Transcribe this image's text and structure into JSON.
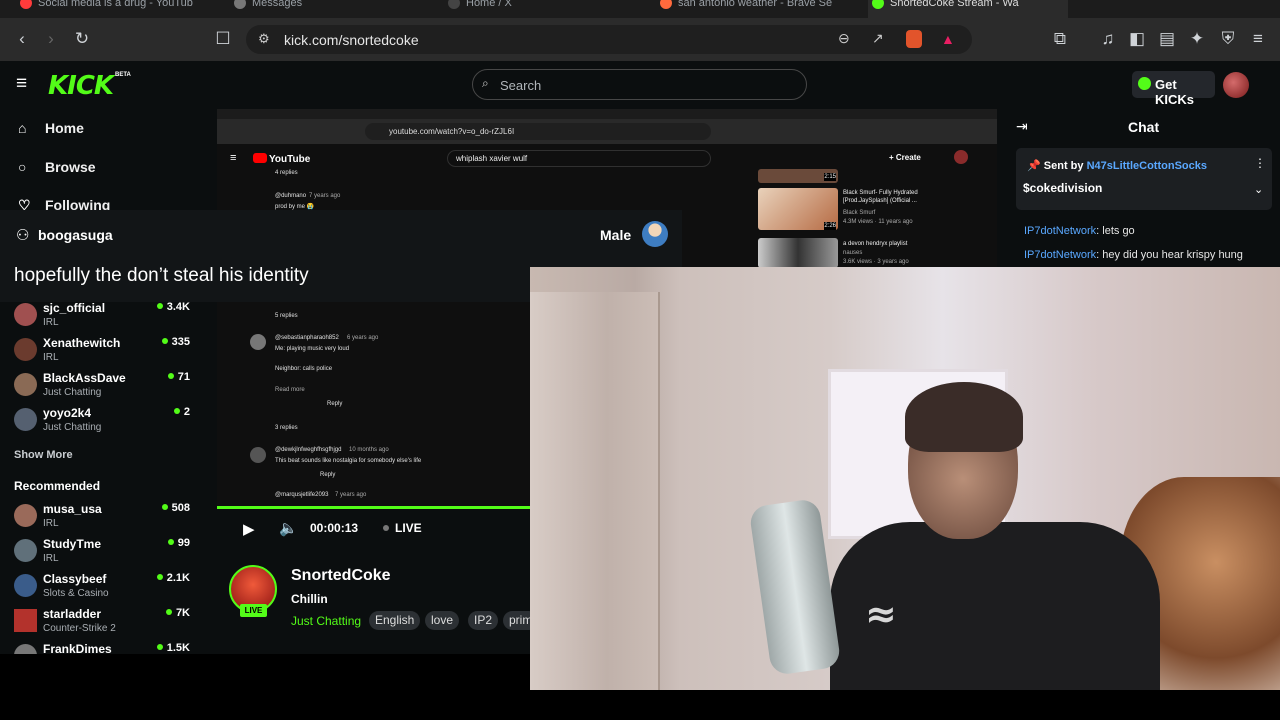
{
  "browser": {
    "tabs": [
      {
        "label": "Social media is a drug - YouTub",
        "color": "#ff3b3b"
      },
      {
        "label": "Messages",
        "color": "#cccccc"
      },
      {
        "label": "Home / X",
        "color": "#ffffff"
      },
      {
        "label": "san antonio weather - Brave Se",
        "color": "#ff6a3d"
      },
      {
        "label": "SnortedCoke Stream - Wa",
        "color": "#53fc18"
      }
    ],
    "url": "kick.com/snortedcoke"
  },
  "header": {
    "logo": "KICK",
    "logo_badge": "BETA",
    "search_placeholder": "Search",
    "get_kicks": "Get KICKs"
  },
  "sidebar": {
    "nav": [
      {
        "label": "Home",
        "icon": "home-icon"
      },
      {
        "label": "Browse",
        "icon": "browse-icon"
      },
      {
        "label": "Following",
        "icon": "heart-icon"
      }
    ],
    "following": [
      {
        "name": "sjc_official",
        "category": "IRL",
        "viewers": "3.4K"
      },
      {
        "name": "Xenathewitch",
        "category": "IRL",
        "viewers": "335"
      },
      {
        "name": "BlackAssDave",
        "category": "Just Chatting",
        "viewers": "71"
      },
      {
        "name": "yoyo2k4",
        "category": "Just Chatting",
        "viewers": "2"
      }
    ],
    "show_more": "Show More",
    "recommended_title": "Recommended",
    "recommended": [
      {
        "name": "musa_usa",
        "category": "IRL",
        "viewers": "508"
      },
      {
        "name": "StudyTme",
        "category": "IRL",
        "viewers": "99"
      },
      {
        "name": "Classybeef",
        "category": "Slots & Casino",
        "viewers": "2.1K"
      },
      {
        "name": "starladder",
        "category": "Counter-Strike 2",
        "viewers": "7K"
      },
      {
        "name": "FrankDimes",
        "category": "",
        "viewers": "1.5K"
      }
    ]
  },
  "alert": {
    "username": "boogasuga",
    "gender": "Male",
    "message": "hopefully the don’t steal his identity"
  },
  "capture": {
    "url": "youtube.com/watch?v=o_do-rZJL6I",
    "search": "whiplash xavier wulf",
    "create": "Create",
    "comments": [
      {
        "text": "4 replies",
        "meta": ""
      },
      {
        "text": "@duhmano",
        "meta": "7 years ago"
      },
      {
        "text": "prod by me 😭",
        "meta": ""
      },
      {
        "text": "5 replies",
        "meta": ""
      },
      {
        "text": "@sebastianpharaoh852",
        "meta": "6 years ago"
      },
      {
        "text": "Me: playing music very loud",
        "meta": ""
      },
      {
        "text": "Neighbor: calls police",
        "meta": ""
      },
      {
        "text": "Read more",
        "meta": ""
      },
      {
        "text": "Reply",
        "meta": ""
      },
      {
        "text": "3 replies",
        "meta": ""
      },
      {
        "text": "@dewkjlnfweghfhsgfhjgd",
        "meta": "10 months ago"
      },
      {
        "text": "This beat sounds like nostalgia for somebody else's life",
        "meta": ""
      },
      {
        "text": "Reply",
        "meta": ""
      },
      {
        "text": "@marqusjetlife2093",
        "meta": "7 years ago"
      }
    ],
    "related": [
      {
        "title": "Black Smurf- Fully Hydrated [Prod.JaySplash] (Official ...",
        "channel": "Black Smurf",
        "meta": "4.3M views · 11 years ago",
        "duration": "2:26"
      },
      {
        "title": "a devon hendryx playlist",
        "channel": "nauses",
        "meta": "3.6K views · 3 years ago",
        "duration": ""
      }
    ],
    "top_duration": "2:15"
  },
  "player": {
    "time": "00:00:13",
    "live": "LIVE",
    "progress": 1.0
  },
  "stream": {
    "name": "SnortedCoke",
    "title": "Chillin",
    "category": "Just Chatting",
    "live_badge": "LIVE",
    "tags": [
      "English",
      "love",
      "IP2",
      "prim"
    ]
  },
  "chat": {
    "title": "Chat",
    "pinned_by_label": "Sent by",
    "pinned_by_user": "N47sLittleCottonSocks",
    "pinned_message": "$cokedivision",
    "messages": [
      {
        "user": "IP7dotNetwork",
        "text": ": lets go"
      },
      {
        "user": "IP7dotNetwork",
        "text": ": hey did you hear krispy hung"
      }
    ]
  }
}
